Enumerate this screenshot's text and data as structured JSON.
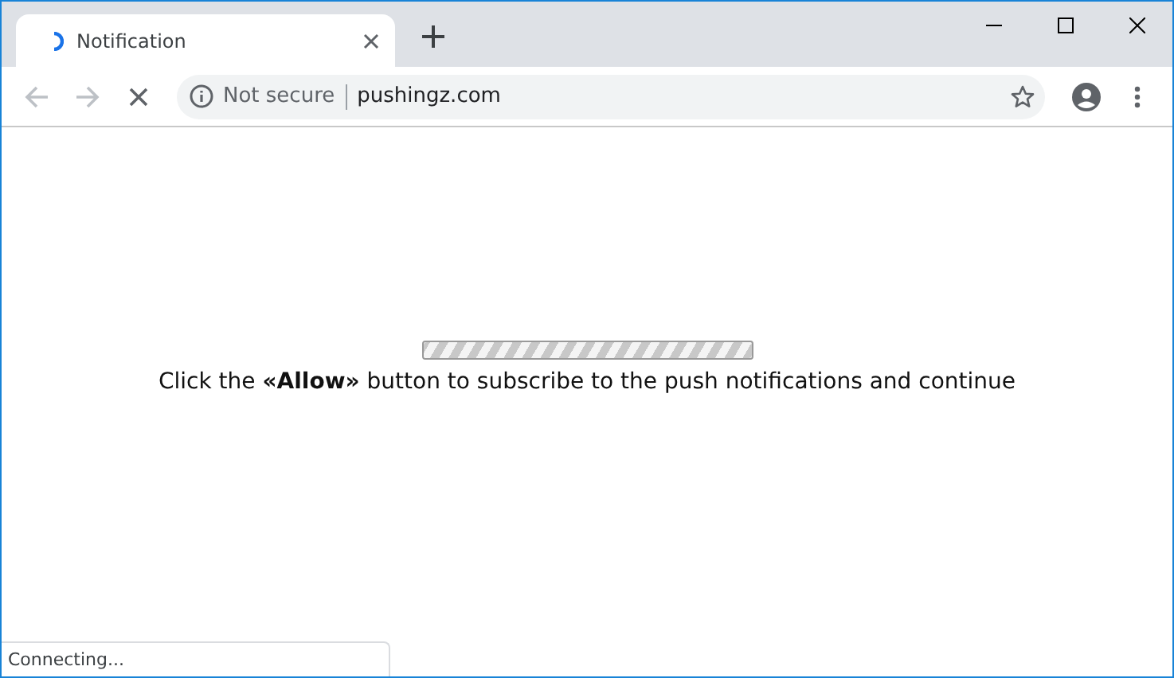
{
  "tabs": [
    {
      "title": "Notification",
      "selected": true,
      "loading": true
    }
  ],
  "address_bar": {
    "security": "Not secure",
    "url": "pushingz.com",
    "loading": true
  },
  "page": {
    "progress": {
      "level": 1
    },
    "message": "Click the **«Allow»** button to subscribe to the push notifications and continue"
  },
  "status_bubble": "Connecting..."
}
